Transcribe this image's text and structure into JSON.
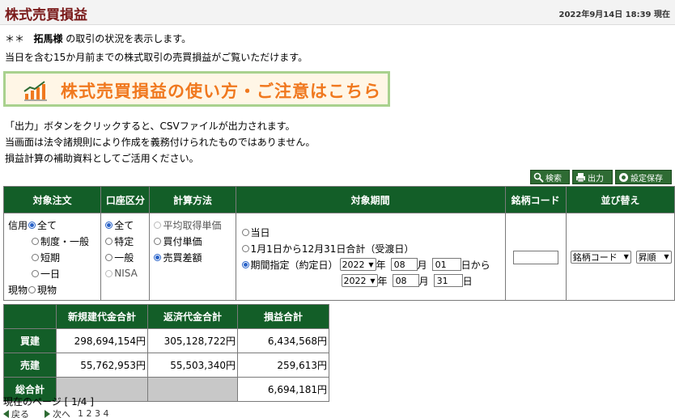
{
  "header": {
    "title": "株式売買損益",
    "datetime": "2022年9月14日 18:39 現在"
  },
  "intro": {
    "masked": "＊＊",
    "name": "拓馬様",
    "line1_rest": " の取引の状況を表示します。",
    "line2": "当日を含む15か月前までの株式取引の売買損益がご覧いただけます。"
  },
  "banner": {
    "text": "株式売買損益の使い方・ご注意はこちら"
  },
  "notes": [
    "「出力」ボタンをクリックすると、CSVファイルが出力されます。",
    "当画面は法令諸規則により作成を義務付けられたものではありません。",
    "損益計算の補助資料としてご活用ください。"
  ],
  "toolbar": {
    "search": "検索",
    "output": "出力",
    "save": "設定保存"
  },
  "search_table": {
    "headers": [
      "対象注文",
      "口座区分",
      "計算方法",
      "対象期間",
      "銘柄コード",
      "並び替え"
    ],
    "order": {
      "shinyo_label": "信用",
      "genbutsu_label": "現物",
      "options": [
        "全て",
        "制度・一般",
        "短期",
        "一日"
      ],
      "genbutsu_option": "現物"
    },
    "account": {
      "options": [
        "全て",
        "特定",
        "一般",
        "NISA"
      ]
    },
    "calc": {
      "options": [
        "平均取得単価",
        "買付単価",
        "売買差額"
      ]
    },
    "period": {
      "options": [
        "当日",
        "1月1日から12月31日合計（受渡日）",
        "期間指定（約定日）"
      ],
      "from": {
        "year": "2022",
        "month": "08",
        "day": "01"
      },
      "to": {
        "year": "2022",
        "month": "08",
        "day": "31"
      },
      "year_unit": "年",
      "month_unit": "月",
      "day_unit": "日",
      "from_suffix": "から"
    },
    "code": {
      "value": ""
    },
    "sort": {
      "key": "銘柄コード",
      "order": "昇順"
    }
  },
  "summary": {
    "headers": [
      "新規建代金合計",
      "返済代金合計",
      "損益合計"
    ],
    "rows": [
      {
        "label": "買建",
        "new": "298,694,154円",
        "repay": "305,128,722円",
        "pl": "6,434,568円"
      },
      {
        "label": "売建",
        "new": "55,762,953円",
        "repay": "55,503,340円",
        "pl": "259,613円"
      },
      {
        "label": "総合計",
        "new": "",
        "repay": "",
        "pl": "6,694,181円"
      }
    ]
  },
  "pager": {
    "text": "現在のページ [ 1/4 ]",
    "back": "戻る",
    "next": "次へ",
    "pages": "1 2 3 4"
  },
  "colors": {
    "header_green": "#135e28",
    "button_green": "#2e6b33",
    "title_red": "#7a1a1a",
    "banner_orange": "#f0781e",
    "banner_border": "#a9d18e"
  }
}
